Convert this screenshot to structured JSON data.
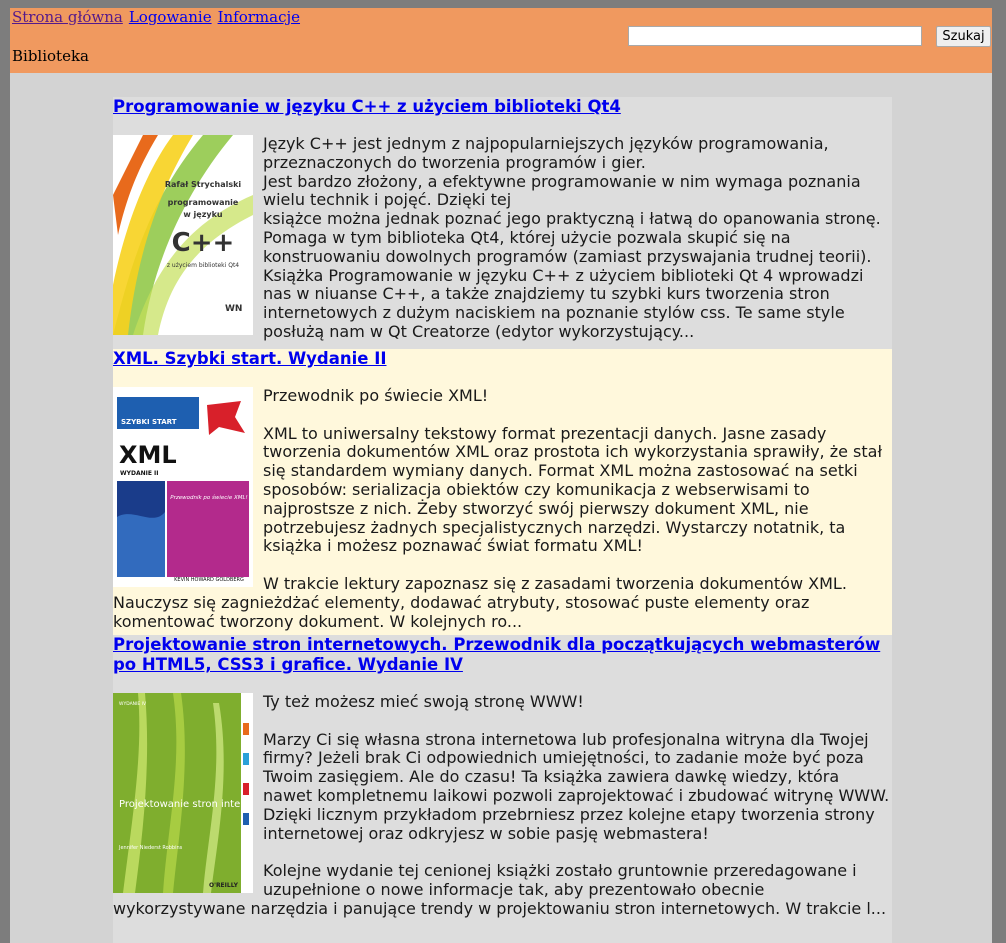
{
  "nav": {
    "home": "Strona główna",
    "login": "Logowanie",
    "info": "Informacje"
  },
  "site": {
    "title": "Biblioteka"
  },
  "search": {
    "value": "",
    "button": "Szukaj"
  },
  "books": [
    {
      "title": "Programowanie w języku C++ z użyciem biblioteki Qt4",
      "cover_text": {
        "author": "Rafał Strychalski",
        "line1": "programowanie",
        "line2": "w języku",
        "lang": "C++",
        "sub": "z użyciem biblioteki Qt4",
        "publisher": "WN"
      },
      "description": "Język C++ jest jednym z najpopularniejszych języków programowania, przeznaczonych do tworzenia programów i gier.\nJest bardzo złożony, a efektywne programowanie w nim wymaga poznania wielu technik i pojęć. Dzięki tej\nksiążce można jednak poznać jego praktyczną i łatwą do opanowania stronę. Pomaga w tym biblioteka Qt4, której użycie pozwala skupić się na konstruowaniu dowolnych programów (zamiast przyswajania trudnej teorii). Książka Programowanie w języku C++ z użyciem biblioteki Qt 4 wprowadzi nas w niuanse C++, a także znajdziemy tu szybki kurs tworzenia stron internetowych z dużym naciskiem na poznanie stylów css. Te same style posłużą nam w Qt Creatorze (edytor wykorzystujący..."
    },
    {
      "title": "XML. Szybki start. Wydanie II",
      "cover_text": {
        "series": "SZYBKI START",
        "name": "XML",
        "edition": "WYDANIE II",
        "tag": "Przewodnik po świecie XML!",
        "author": "KEVIN HOWARD GOLDBERG"
      },
      "description": "Przewodnik po świecie XML!\n\nXML to uniwersalny tekstowy format prezentacji danych. Jasne zasady tworzenia dokumentów XML oraz prostota ich wykorzystania sprawiły, że stał się standardem wymiany danych. Format XML można zastosować na setki sposobów: serializacja obiektów czy komunikacja z webserwisami to najprostsze z nich. Żeby stworzyć swój pierwszy dokument XML, nie potrzebujesz żadnych specjalistycznych narzędzi. Wystarczy notatnik, ta książka i możesz poznawać świat formatu XML!\n\nW trakcie lektury zapoznasz się z zasadami tworzenia dokumentów XML. Nauczysz się zagnieżdżać elementy, dodawać atrybuty, stosować puste elementy oraz komentować tworzony dokument. W kolejnych ro..."
    },
    {
      "title": "Projektowanie stron internetowych. Przewodnik dla początkujących webmasterów po HTML5, CSS3 i grafice. Wydanie IV",
      "cover_text": {
        "edition": "WYDANIE IV",
        "name": "Projektowanie stron internetowych",
        "author": "Jennifer Niederst Robbins",
        "publisher": "O'REILLY"
      },
      "description": "Ty też możesz mieć swoją stronę WWW!\n\nMarzy Ci się własna strona internetowa lub profesjonalna witryna dla Twojej firmy? Jeżeli brak Ci odpowiednich umiejętności, to zadanie może być poza Twoim zasięgiem. Ale do czasu! Ta książka zawiera dawkę wiedzy, która nawet kompletnemu laikowi pozwoli zaprojektować i zbudować witrynę WWW. Dzięki licznym przykładom przebrniesz przez kolejne etapy tworzenia strony internetowej oraz odkryjesz w sobie pasję webmastera!\n\nKolejne wydanie tej cenionej książki zostało gruntownie przeredagowane i uzupełnione o nowe informacje tak, aby prezentowało obecnie wykorzystywane narzędzia i panujące trendy w projektowaniu stron internetowych. W trakcie l..."
    }
  ]
}
